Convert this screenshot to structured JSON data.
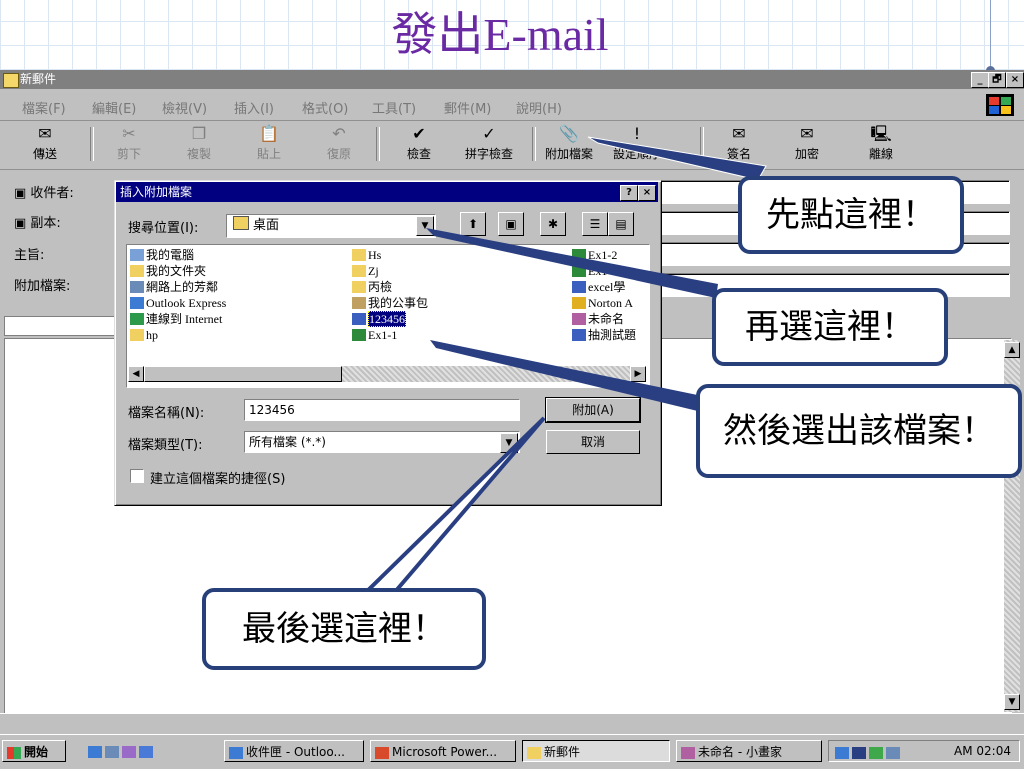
{
  "slide": {
    "title_cjk": "發出",
    "title_latin": "E-mail"
  },
  "window": {
    "title": "新郵件",
    "controls": {
      "minimize": "_",
      "maximize": "🗗",
      "close": "×"
    }
  },
  "menubar": {
    "items": [
      "檔案(F)",
      "編輯(E)",
      "檢視(V)",
      "插入(I)",
      "格式(O)",
      "工具(T)",
      "郵件(M)",
      "說明(H)"
    ]
  },
  "toolbar": {
    "send": "傳送",
    "cut": "剪下",
    "copy": "複製",
    "paste": "貼上",
    "undo": "復原",
    "check": "檢查",
    "spell": "拼字檢查",
    "attach": "附加檔案",
    "priority": "設定順序",
    "sign": "簽名",
    "encrypt": "加密",
    "offline": "離線"
  },
  "header_fields": {
    "to": "收件者:",
    "cc": "副本:",
    "subject": "主旨:",
    "attach": "附加檔案:"
  },
  "dialog": {
    "title": "插入附加檔案",
    "help_btn": "?",
    "close_btn": "×",
    "lookin_label": "搜尋位置(I):",
    "lookin_value": "桌面",
    "files_col1": [
      "我的電腦",
      "我的文件夾",
      "網路上的芳鄰",
      "Outlook Express",
      "連線到 Internet",
      "hp"
    ],
    "files_col2": [
      "Hs",
      "Zj",
      "丙檢",
      "我的公事包",
      "123456",
      "Ex1-1"
    ],
    "files_col3": [
      "Ex1-2",
      "Ex1-3",
      "excel學",
      "Norton A",
      "未命名",
      "抽測試題"
    ],
    "filename_label": "檔案名稱(N):",
    "filename_value": "123456",
    "filetype_label": "檔案類型(T):",
    "filetype_value": "所有檔案 (*.*)",
    "attach_button": "附加(A)",
    "cancel_button": "取消",
    "shortcut_label": "建立這個檔案的捷徑(S)"
  },
  "callouts": {
    "first": "先點這裡！",
    "second": "再選這裡！",
    "third": "然後選出該檔案！",
    "last": "最後選這裡！"
  },
  "taskbar": {
    "start": "開始",
    "tasks": [
      "收件匣 - Outloo...",
      "Microsoft Power...",
      "新郵件",
      "未命名 - 小畫家"
    ],
    "clock": "AM 02:04"
  }
}
